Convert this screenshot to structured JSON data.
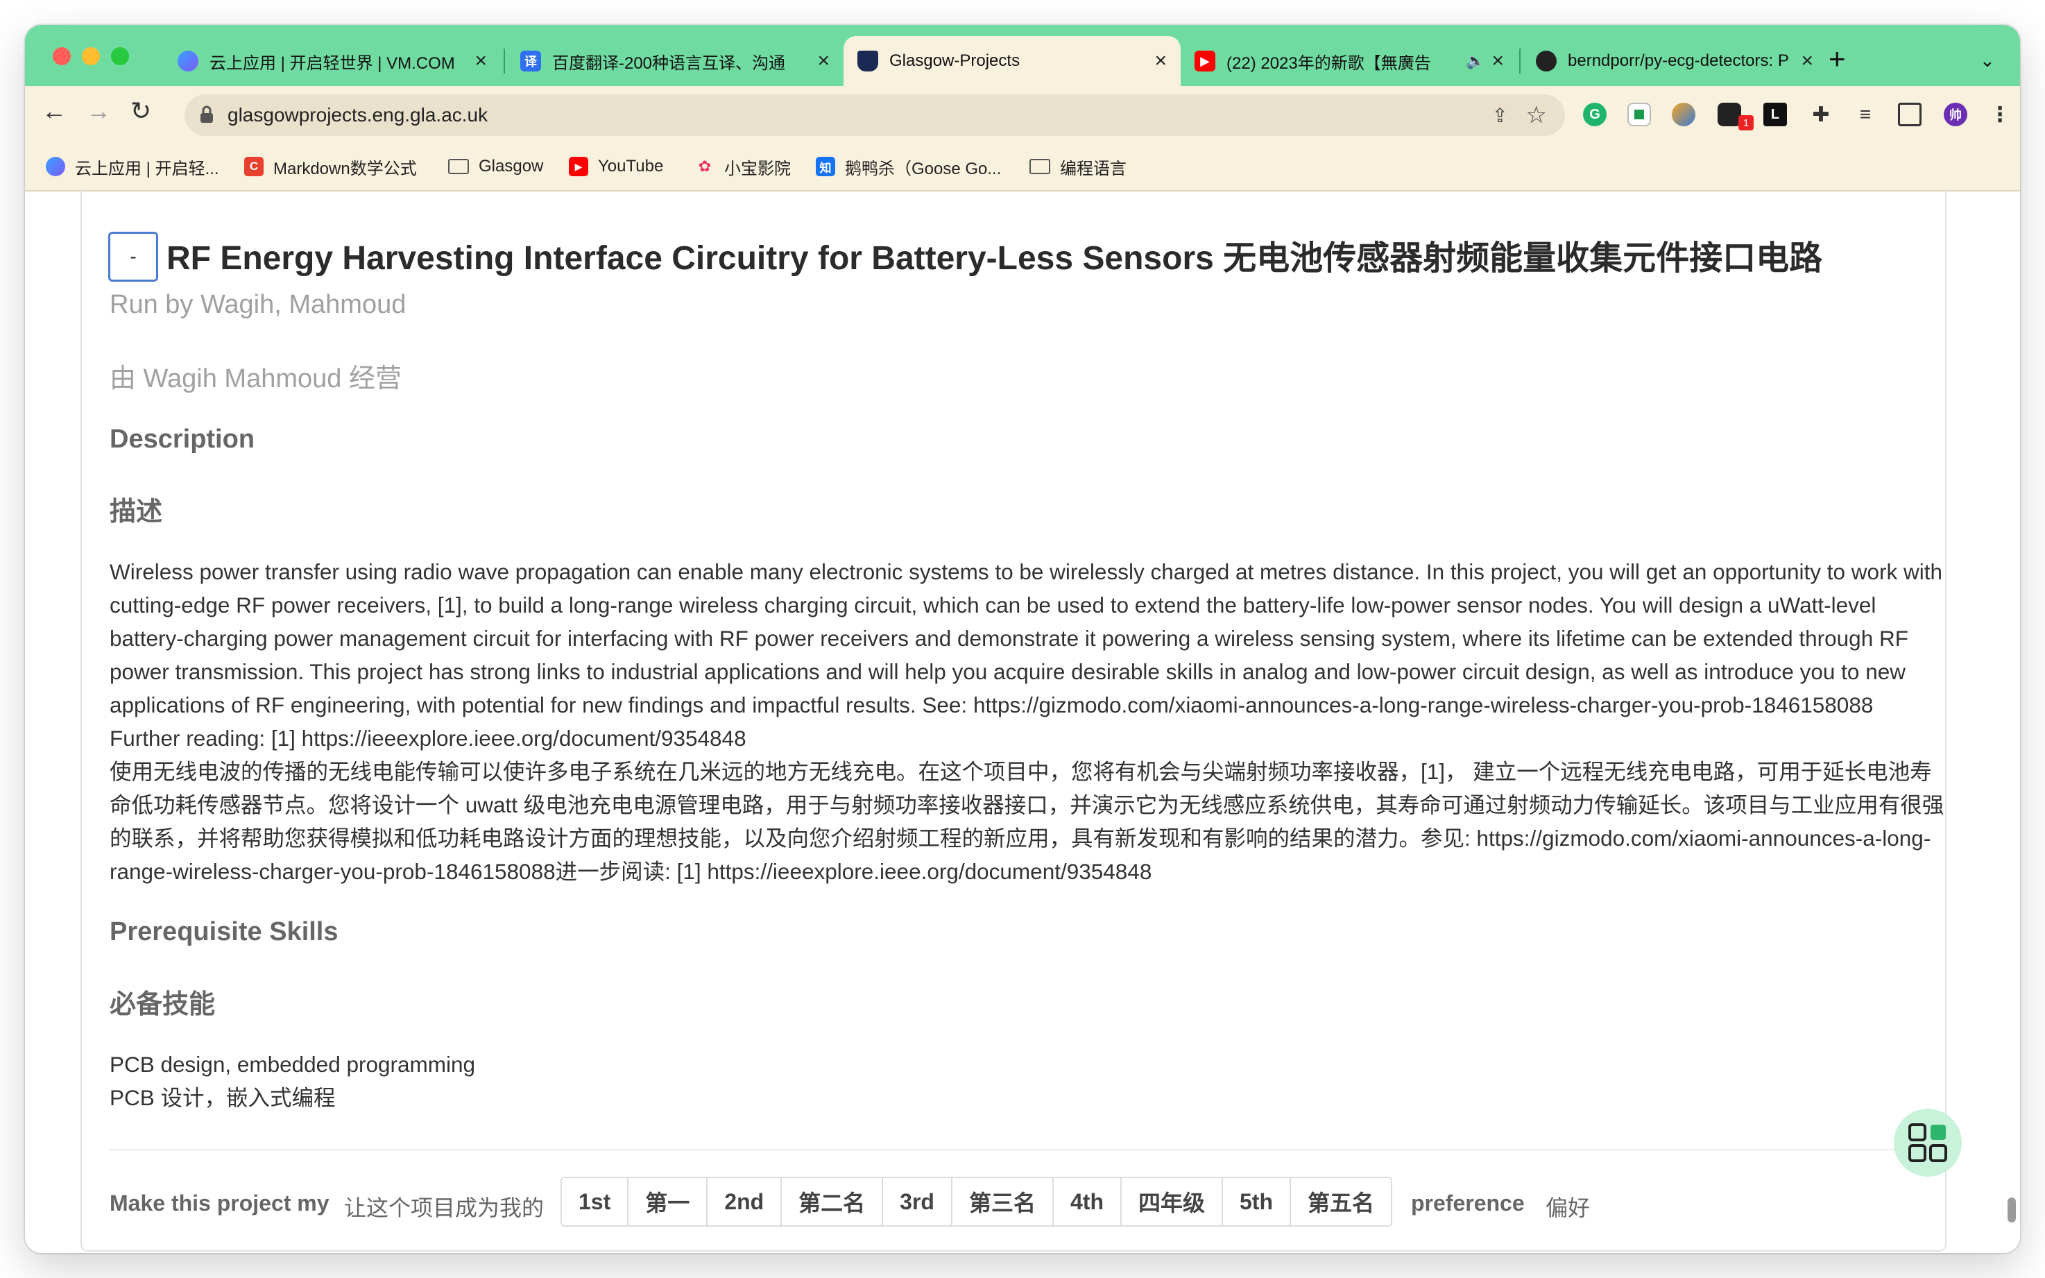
{
  "browser": {
    "tabs": [
      {
        "title": "云上应用 | 开启轻世界 | VM.COM",
        "favicon": "cloud-favicon",
        "active": false
      },
      {
        "title": "百度翻译-200种语言互译、沟通",
        "favicon": "translate-favicon",
        "favicon_text": "译",
        "active": false
      },
      {
        "title": "Glasgow-Projects",
        "favicon": "glasgow-crest-favicon",
        "active": true
      },
      {
        "title": "(22) 2023年的新歌【無廣告",
        "favicon": "youtube-favicon",
        "active": false,
        "audio": "speaker-icon"
      },
      {
        "title": "berndporr/py-ecg-detectors: P",
        "favicon": "github-favicon",
        "active": false
      }
    ],
    "new_tab": "+",
    "url": "glasgowprojects.eng.gla.ac.uk",
    "extension_badge": "1",
    "profile_initial": "帅",
    "bookmarks": [
      {
        "label": "云上应用 | 开启轻...",
        "icon": "cloud-icon"
      },
      {
        "label": "Markdown数学公式",
        "icon": "csdn-icon",
        "icon_text": "C"
      },
      {
        "label": "Glasgow",
        "icon": "folder-icon"
      },
      {
        "label": "YouTube",
        "icon": "youtube-icon"
      },
      {
        "label": "小宝影院",
        "icon": "film-icon"
      },
      {
        "label": "鹅鸭杀（Goose Go...",
        "icon": "zhihu-icon",
        "icon_text": "知"
      },
      {
        "label": "编程语言",
        "icon": "folder-icon"
      }
    ]
  },
  "project": {
    "collapse_label": "-",
    "title": "RF Energy Harvesting Interface Circuitry for Battery-Less Sensors   无电池传感器射频能量收集元件接口电路",
    "run_by": "Run by Wagih, Mahmoud",
    "run_by_cn": "由 Wagih Mahmoud 经营",
    "description_heading": "Description",
    "description_heading_cn": "描述",
    "description_en": "Wireless power transfer using radio wave propagation can enable many electronic systems to be wirelessly charged at metres distance. In this project, you will get an opportunity to work with cutting-edge RF power receivers, [1], to build a long-range wireless charging circuit, which can be used to extend the battery-life low-power sensor nodes. You will design a uWatt-level battery-charging power management circuit for interfacing with RF power receivers and demonstrate it powering a wireless sensing system, where its lifetime can be extended through RF power transmission. This project has strong links to industrial applications and will help you acquire desirable skills in analog and low-power circuit design, as well as introduce you to new applications of RF engineering, with potential for new findings and impactful results. See: https://gizmodo.com/xiaomi-announces-a-long-range-wireless-charger-you-prob-1846158088 Further reading: [1] https://ieeexplore.ieee.org/document/9354848",
    "description_cn": "使用无线电波的传播的无线电能传输可以使许多电子系统在几米远的地方无线充电。在这个项目中，您将有机会与尖端射频功率接收器，[1]， 建立一个远程无线充电电路，可用于延长电池寿命低功耗传感器节点。您将设计一个 uwatt 级电池充电电源管理电路，用于与射频功率接收器接口，并演示它为无线感应系统供电，其寿命可通过射频动力传输延长。该项目与工业应用有很强的联系，并将帮助您获得模拟和低功耗电路设计方面的理想技能，以及向您介绍射频工程的新应用，具有新发现和有影响的结果的潜力。参见: https://gizmodo.com/xiaomi-announces-a-long-range-wireless-charger-you-prob-1846158088进一步阅读: [1] https://ieeexplore.ieee.org/document/9354848",
    "prereq_heading": "Prerequisite Skills",
    "prereq_heading_cn": "必备技能",
    "prereq_en": "PCB design, embedded programming",
    "prereq_cn": "PCB 设计，嵌入式编程",
    "preference": {
      "label_before": "Make this project my",
      "label_before_cn": "让这个项目成为我的",
      "options": [
        "1st",
        "第一",
        "2nd",
        "第二名",
        "3rd",
        "第三名",
        "4th",
        "四年级",
        "5th",
        "第五名"
      ],
      "label_after": "preference",
      "label_after_cn": "偏好"
    }
  },
  "colors": {
    "tab_strip": "#6fdba0",
    "toolbar": "#f8f1de",
    "focus_border": "#4a7bd0",
    "fab_bg": "#c8f2da",
    "fab_tiles": "#2db66b"
  }
}
